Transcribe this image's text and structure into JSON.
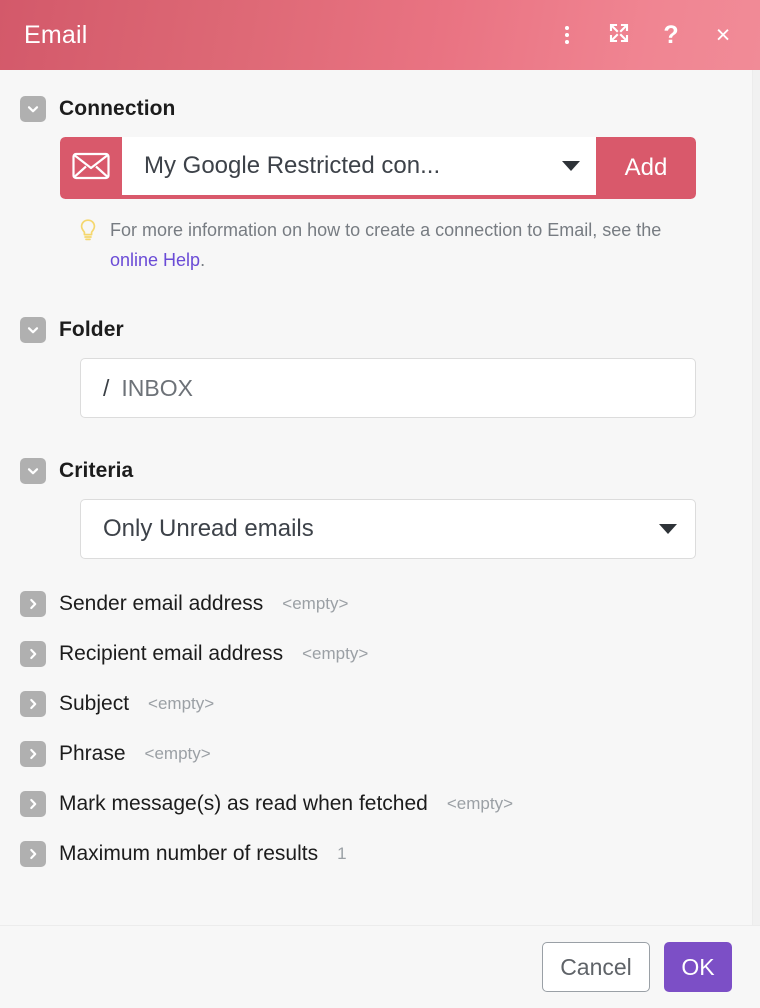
{
  "window": {
    "title": "Email",
    "actions": [
      {
        "name": "more-options",
        "icon": "kebab-menu-icon",
        "label": ""
      },
      {
        "name": "expand",
        "icon": "expand-icon",
        "label": ""
      },
      {
        "name": "help",
        "icon": "question-mark-icon",
        "label": "?"
      },
      {
        "name": "close",
        "icon": "close-icon",
        "label": "×"
      }
    ]
  },
  "colors": {
    "header_left": "#d3596a",
    "header_right": "#f18b97",
    "accent_red": "#d9596b",
    "ok_purple": "#7c4fc6",
    "link_purple": "#6a4bd6",
    "toggle_gray": "#b0b0b0"
  },
  "connection": {
    "section_title": "Connection",
    "icon": "envelope-icon",
    "value": "My Google Restricted con...",
    "add_label": "Add",
    "hint_prefix": "For more information on how to create a connection to Email, see the ",
    "hint_link": "online Help",
    "hint_suffix": "."
  },
  "folder": {
    "section_title": "Folder",
    "separator": "/",
    "value": "INBOX"
  },
  "criteria": {
    "section_title": "Criteria",
    "value": "Only Unread emails"
  },
  "rows": [
    {
      "label": "Sender email address",
      "value": "<empty>"
    },
    {
      "label": "Recipient email address",
      "value": "<empty>"
    },
    {
      "label": "Subject",
      "value": "<empty>"
    },
    {
      "label": "Phrase",
      "value": "<empty>"
    },
    {
      "label": "Mark message(s) as read when fetched",
      "value": "<empty>"
    },
    {
      "label": "Maximum number of results",
      "value": "1"
    }
  ],
  "footer": {
    "cancel_label": "Cancel",
    "ok_label": "OK"
  }
}
